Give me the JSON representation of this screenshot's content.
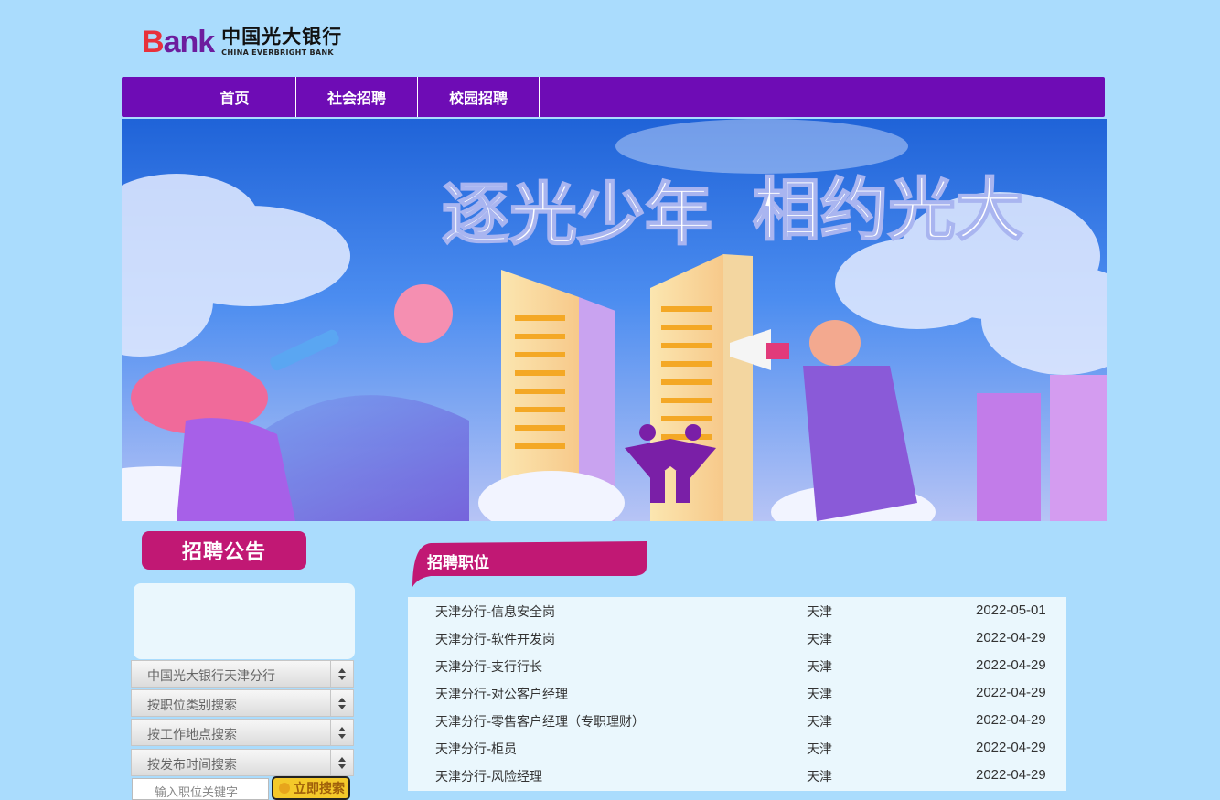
{
  "logo": {
    "mark_b": "B",
    "mark_rest": "ank",
    "name_cn": "中国光大银行",
    "name_en": "CHINA EVERBRIGHT BANK"
  },
  "nav": {
    "items": [
      {
        "label": "首页"
      },
      {
        "label": "社会招聘"
      },
      {
        "label": "校园招聘"
      }
    ]
  },
  "banner": {
    "slogan_left": "逐光少年",
    "slogan_right": "相约光大"
  },
  "sidebar": {
    "notice_title": "招聘公告",
    "filters": [
      {
        "label": "中国光大银行天津分行"
      },
      {
        "label": "按职位类别搜索"
      },
      {
        "label": "按工作地点搜索"
      },
      {
        "label": "按发布时间搜索"
      }
    ],
    "search_placeholder": "输入职位关键字",
    "search_button": "立即搜索"
  },
  "jobs": {
    "title": "招聘职位",
    "rows": [
      {
        "title": "天津分行-信息安全岗",
        "location": "天津",
        "date": "2022-05-01"
      },
      {
        "title": "天津分行-软件开发岗",
        "location": "天津",
        "date": "2022-04-29"
      },
      {
        "title": "天津分行-支行行长",
        "location": "天津",
        "date": "2022-04-29"
      },
      {
        "title": "天津分行-对公客户经理",
        "location": "天津",
        "date": "2022-04-29"
      },
      {
        "title": "天津分行-零售客户经理（专职理财）",
        "location": "天津",
        "date": "2022-04-29"
      },
      {
        "title": "天津分行-柜员",
        "location": "天津",
        "date": "2022-04-29"
      },
      {
        "title": "天津分行-风险经理",
        "location": "天津",
        "date": "2022-04-29"
      }
    ]
  },
  "colors": {
    "background": "#aadcfd",
    "nav": "#6e0cb5",
    "accent_magenta": "#c11874",
    "panel": "#eaf7fd"
  }
}
